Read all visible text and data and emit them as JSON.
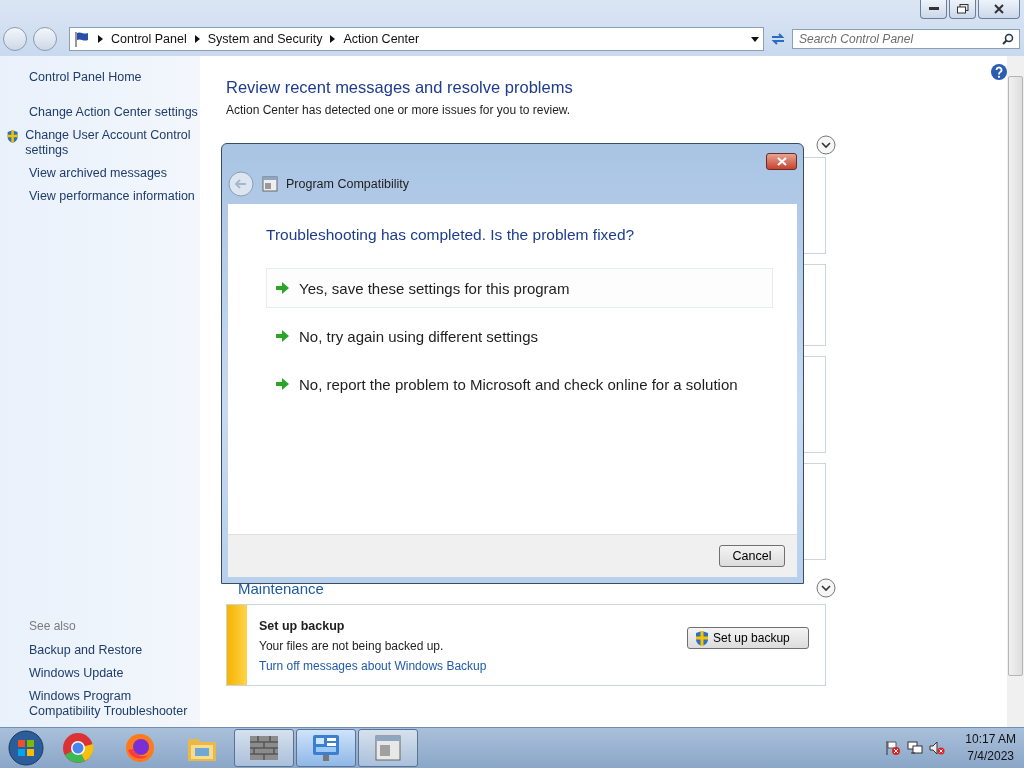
{
  "window": {
    "breadcrumb": [
      "Control Panel",
      "System and Security",
      "Action Center"
    ],
    "search": {
      "placeholder": "Search Control Panel"
    }
  },
  "sidebar": {
    "items": [
      {
        "label": "Control Panel Home",
        "kind": "home"
      },
      {
        "label": "Change Action Center settings",
        "kind": "link"
      },
      {
        "label": "Change User Account Control settings",
        "kind": "shield"
      },
      {
        "label": "View archived messages",
        "kind": "link"
      },
      {
        "label": "View performance information",
        "kind": "link"
      }
    ],
    "see_also": {
      "title": "See also",
      "items": [
        "Backup and Restore",
        "Windows Update",
        "Windows Program Compatibility Troubleshooter"
      ]
    }
  },
  "main": {
    "title": "Review recent messages and resolve problems",
    "subtitle": "Action Center has detected one or more issues for you to review.",
    "maintenance": {
      "title": "Maintenance",
      "expanded": false
    },
    "backup": {
      "title": "Set up backup",
      "message": "Your files are not being backed up.",
      "link": "Turn off messages about Windows Backup",
      "button": "Set up backup"
    }
  },
  "dialog": {
    "title": "Program Compatibility",
    "heading": "Troubleshooting has completed.  Is the problem fixed?",
    "options": [
      {
        "label": "Yes, save these settings for this program",
        "selected": true
      },
      {
        "label": "No, try again using different settings",
        "selected": false
      },
      {
        "label": "No, report the problem to Microsoft and check online for a solution",
        "selected": false
      }
    ],
    "cancel": "Cancel"
  },
  "taskbar": {
    "apps": [
      {
        "kind": "chrome",
        "active": false
      },
      {
        "kind": "firefox",
        "active": false
      },
      {
        "kind": "explorer",
        "active": false
      },
      {
        "kind": "firewall",
        "active": false
      },
      {
        "kind": "control-panel",
        "active": true
      },
      {
        "kind": "compat",
        "active": false
      }
    ],
    "clock": {
      "time": "10:17 AM",
      "date": "7/4/2023"
    }
  }
}
